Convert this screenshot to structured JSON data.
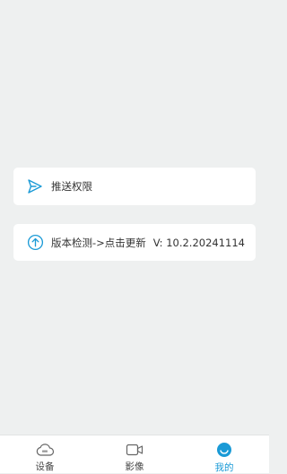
{
  "settings": {
    "push": {
      "label": "推送权限",
      "icon": "send-icon"
    },
    "version": {
      "label": "版本检测->点击更新",
      "value": "V: 10.2.20241114",
      "icon": "upload-circle-icon"
    }
  },
  "tabbar": {
    "active_color": "#1a9ad6",
    "items": [
      {
        "label": "设备",
        "icon": "cloud-camera-icon",
        "active": false
      },
      {
        "label": "影像",
        "icon": "video-camera-icon",
        "active": false
      },
      {
        "label": "我的",
        "icon": "profile-icon",
        "active": true
      }
    ]
  }
}
